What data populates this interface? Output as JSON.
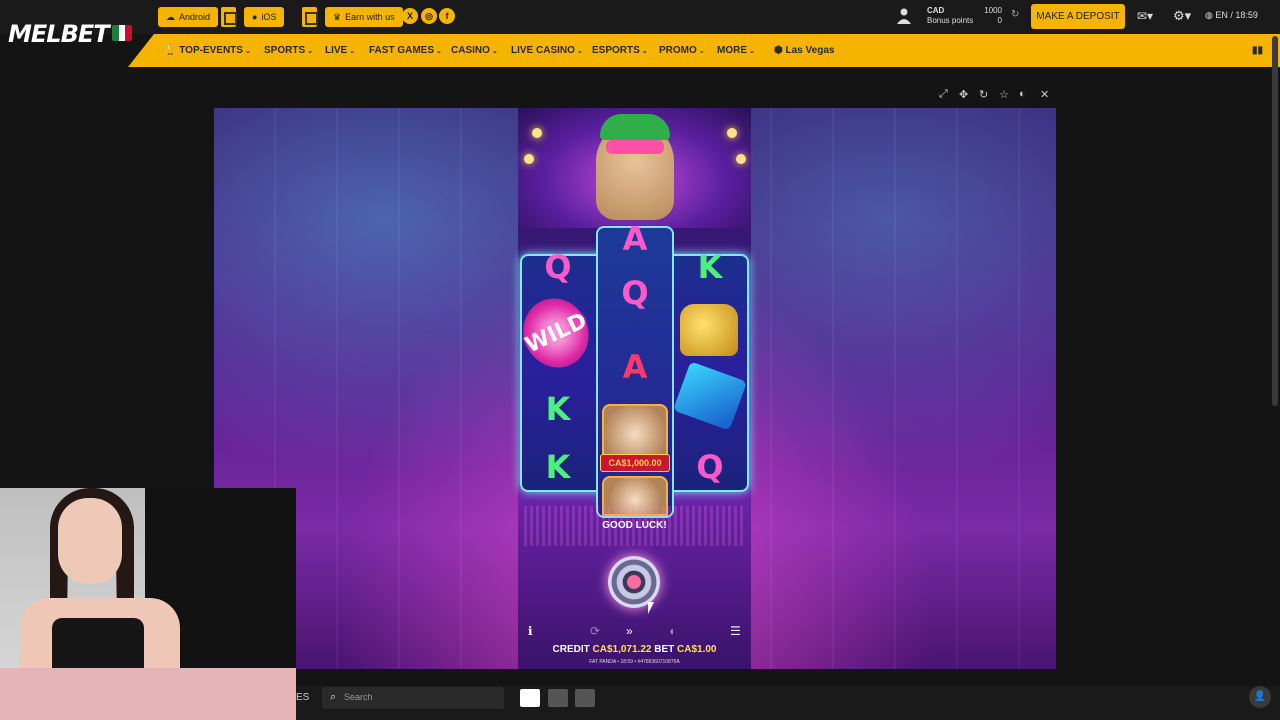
{
  "header": {
    "logo": "MELBET",
    "android": "Android",
    "ios": "iOS",
    "earn": "Earn with us",
    "currency": "CAD",
    "bonus_label": "Bonus points",
    "balance": "1000",
    "bonus_value": "0",
    "deposit": "MAKE A DEPOSIT",
    "lang_time": "EN / 18:59"
  },
  "nav": {
    "items": [
      "TOP-EVENTS",
      "SPORTS",
      "LIVE",
      "FAST GAMES",
      "CASINO",
      "LIVE CASINO",
      "ESPORTS",
      "PROMO",
      "MORE"
    ],
    "las_vegas": "Las Vegas"
  },
  "game": {
    "symbols": [
      "Q",
      "A",
      "Q",
      "A",
      "K",
      "K",
      "K",
      "Q"
    ],
    "wild": "WILD",
    "prize": "CA$1,000.00",
    "good_luck": "GOOD LUCK!",
    "credit_label": "CREDIT",
    "credit_value": "CA$1,071.22",
    "bet_label": "BET",
    "bet_value": "CA$1.00",
    "footer": "FAT PANDA • 18:59 • #4786360710876A"
  },
  "bottom": {
    "tab_suffix": "ES",
    "search_placeholder": "Search"
  },
  "colors": {
    "accent": "#f4b400",
    "bg": "#141414"
  }
}
